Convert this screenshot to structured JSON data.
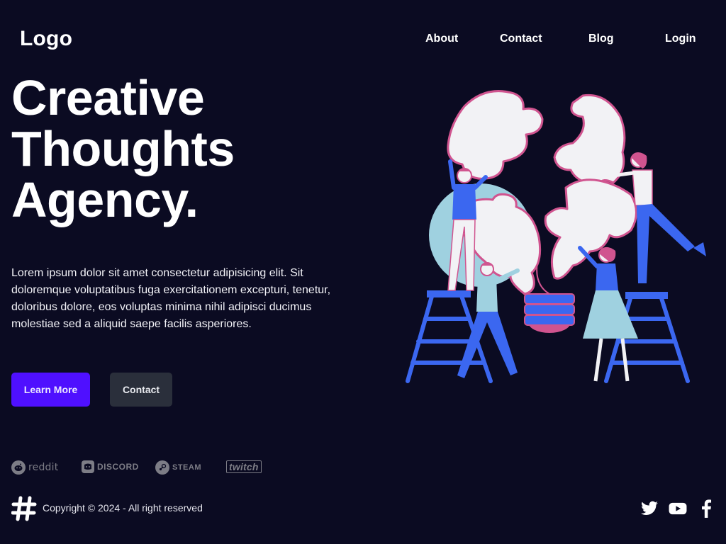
{
  "header": {
    "logo": "Logo",
    "nav": {
      "about": "About",
      "contact": "Contact",
      "blog": "Blog",
      "login": "Login"
    }
  },
  "hero": {
    "headline_lines": [
      "Creative",
      "Thoughts",
      "Agency."
    ],
    "description": "Lorem ipsum dolor sit amet consectetur adipisicing elit. Sit doloremque voluptatibus fuga exercitationem excepturi, tenetur, doloribus dolore, eos voluptas minima nihil adipisci ducimus molestiae sed a aliquid saepe facilis asperiores.",
    "primary_button": "Learn More",
    "secondary_button": "Contact"
  },
  "brands": [
    {
      "name": "reddit",
      "icon": "reddit-icon"
    },
    {
      "name": "DISCORD",
      "icon": "discord-icon"
    },
    {
      "name": "STEAM",
      "icon": "steam-icon"
    },
    {
      "name": "twitch",
      "icon": "twitch-icon"
    }
  ],
  "footer": {
    "copyright": "Copyright © 2024 - All right reserved",
    "social": [
      "twitter-icon",
      "youtube-icon",
      "facebook-icon"
    ]
  },
  "colors": {
    "background": "#0b0b22",
    "primary": "#4f10ff",
    "secondary": "#2a2f3b",
    "illustration_blue": "#3b67f0",
    "illustration_pink": "#d0548f",
    "illustration_light_blue": "#9fd1e0"
  }
}
